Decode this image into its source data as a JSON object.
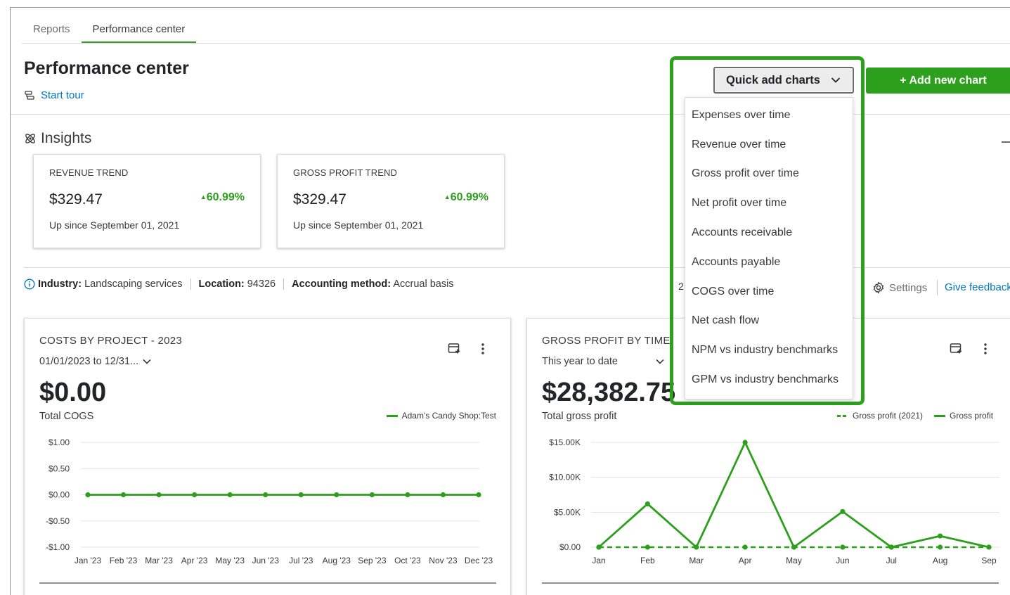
{
  "tabs": [
    {
      "label": "Reports"
    },
    {
      "label": "Performance center"
    }
  ],
  "header": {
    "title": "Performance center",
    "start_tour": "Start tour"
  },
  "quick_add": {
    "label": "Quick add charts",
    "add_new_label": "+ Add new chart",
    "items": [
      {
        "label": "Expenses over time"
      },
      {
        "label": "Revenue over time"
      },
      {
        "label": "Gross profit over time"
      },
      {
        "label": "Net profit over time"
      },
      {
        "label": "Accounts receivable"
      },
      {
        "label": "Accounts payable"
      },
      {
        "label": "COGS over time"
      },
      {
        "label": "Net cash flow"
      },
      {
        "label": "NPM vs industry benchmarks"
      },
      {
        "label": "GPM vs industry benchmarks"
      }
    ]
  },
  "insights": {
    "title": "Insights",
    "cards": [
      {
        "label": "REVENUE TREND",
        "amount": "$329.47",
        "change": "60.99%",
        "since": "Up since September 01, 2021"
      },
      {
        "label": "GROSS PROFIT TREND",
        "amount": "$329.47",
        "change": "60.99%",
        "since": "Up since September 01, 2021"
      }
    ]
  },
  "meta": {
    "industry_label": "Industry:",
    "industry": "Landscaping services",
    "location_label": "Location:",
    "location": "94326",
    "method_label": "Accounting method:",
    "method": "Accrual basis",
    "settings": "Settings",
    "feedback": "Give feedback",
    "stray": "2"
  },
  "colors": {
    "brand_green": "#2ca01c",
    "link_blue": "#0077c5"
  },
  "cards": {
    "costs": {
      "title": "COSTS BY PROJECT - 2023",
      "date_range": "01/01/2023 to 12/31...",
      "amount": "$0.00",
      "subtitle": "Total COGS",
      "legend": "Adam's Candy Shop:Test"
    },
    "gross": {
      "title": "GROSS PROFIT BY TIME",
      "date_range": "This year to date",
      "amount": "$28,382.75",
      "subtitle": "Total gross profit",
      "legend_prev": "Gross profit (2021)",
      "legend_curr": "Gross profit"
    }
  },
  "chart_data": [
    {
      "type": "line",
      "title": "COSTS BY PROJECT - 2023",
      "categories": [
        "Jan '23",
        "Feb '23",
        "Mar '23",
        "Apr '23",
        "May '23",
        "Jun '23",
        "Jul '23",
        "Aug '23",
        "Sep '23",
        "Oct '23",
        "Nov '23",
        "Dec '23"
      ],
      "y_ticks": [
        "$1.00",
        "$0.50",
        "$0.00",
        "-$0.50",
        "-$1.00"
      ],
      "ylim": [
        -1,
        1
      ],
      "series": [
        {
          "name": "Adam's Candy Shop:Test",
          "values": [
            0,
            0,
            0,
            0,
            0,
            0,
            0,
            0,
            0,
            0,
            0,
            0
          ]
        }
      ]
    },
    {
      "type": "line",
      "title": "GROSS PROFIT BY TIME",
      "categories": [
        "Jan",
        "Feb",
        "Mar",
        "Apr",
        "May",
        "Jun",
        "Jul",
        "Aug",
        "Sep"
      ],
      "y_ticks": [
        "$15.00K",
        "$10.00K",
        "$5.00K",
        "$0.00"
      ],
      "ylim": [
        0,
        15000
      ],
      "series": [
        {
          "name": "Gross profit (2021)",
          "style": "dashed",
          "values": [
            0,
            0,
            0,
            0,
            0,
            0,
            0,
            0,
            0
          ]
        },
        {
          "name": "Gross profit",
          "style": "solid",
          "values": [
            0,
            6200,
            0,
            15000,
            0,
            5100,
            0,
            1600,
            0
          ]
        }
      ]
    }
  ]
}
